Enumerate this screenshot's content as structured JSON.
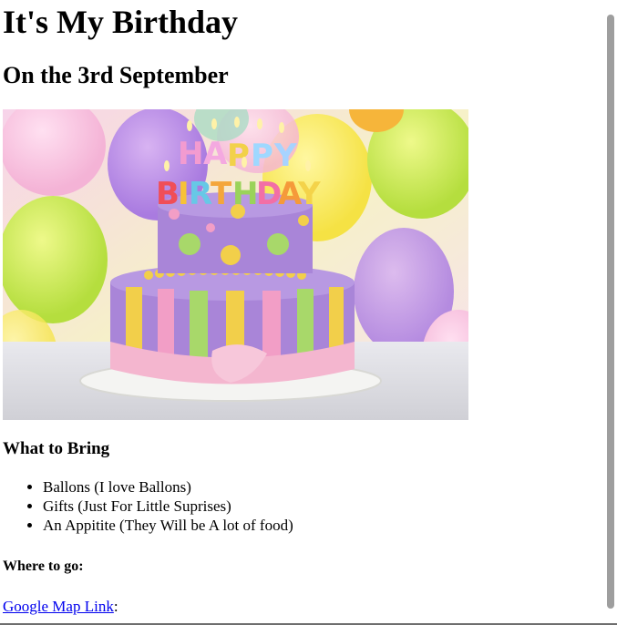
{
  "page": {
    "title": "It's My Birthday",
    "subtitle": "On the 3rd September"
  },
  "image": {
    "alt": "Birthday cake"
  },
  "bring": {
    "heading": "What to Bring",
    "items": [
      "Ballons (I love Ballons)",
      "Gifts (Just For Little Suprises)",
      "An Appitite (They Will be A lot of food)"
    ]
  },
  "where": {
    "heading": "Where to go:",
    "link_text": "Google Map Link",
    "after_link": ":"
  },
  "colors": {
    "link": "#0000ee",
    "scrollbar_thumb": "#9e9e9e",
    "cake_purple": "#9b7fd4",
    "cake_pink": "#f4b6cf",
    "cake_yellow": "#f2cf4a"
  },
  "candle_letters": {
    "top": "HAPPY",
    "bottom": "BIRTHDAY"
  }
}
